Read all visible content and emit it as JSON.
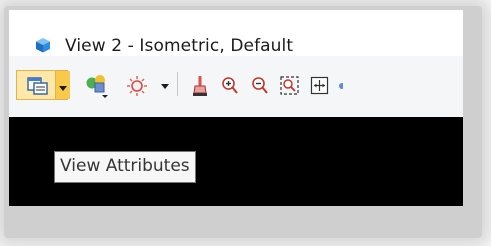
{
  "window": {
    "title": "View 2 - Isometric, Default"
  },
  "toolbar": {
    "buttons": [
      {
        "name": "view-attributes",
        "icon": "view-attributes-icon",
        "has_dropdown": true,
        "active": true
      },
      {
        "name": "display-style",
        "icon": "display-style-icon",
        "has_dropdown": true
      },
      {
        "name": "lights",
        "icon": "light-icon",
        "has_dropdown": true
      },
      {
        "name": "update-view",
        "icon": "paint-brush-icon"
      },
      {
        "name": "zoom-in",
        "icon": "zoom-in-icon"
      },
      {
        "name": "zoom-out",
        "icon": "zoom-out-icon"
      },
      {
        "name": "window-area",
        "icon": "window-area-icon"
      },
      {
        "name": "fit-view",
        "icon": "fit-view-icon"
      }
    ]
  },
  "tooltip": {
    "text": "View Attributes"
  },
  "colors": {
    "active_button_fill": "#fde7a9",
    "active_button_border": "#e3b24a",
    "viewport_background": "#000000"
  }
}
